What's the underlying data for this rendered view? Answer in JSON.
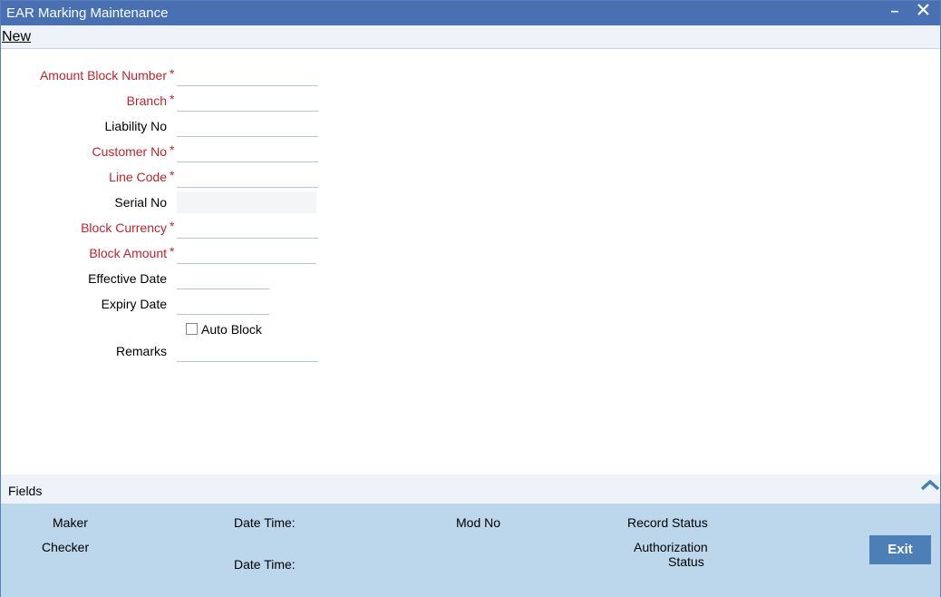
{
  "window": {
    "title": "EAR Marking Maintenance"
  },
  "toolbar": {
    "new_label": "New"
  },
  "form": {
    "amount_block_number": {
      "label": "Amount Block Number",
      "value": ""
    },
    "branch": {
      "label": "Branch",
      "value": ""
    },
    "liability_no": {
      "label": "Liability No",
      "value": ""
    },
    "customer_no": {
      "label": "Customer No",
      "value": ""
    },
    "line_code": {
      "label": "Line Code",
      "value": ""
    },
    "serial_no": {
      "label": "Serial No",
      "value": ""
    },
    "block_currency": {
      "label": "Block Currency",
      "value": ""
    },
    "block_amount": {
      "label": "Block Amount",
      "value": ""
    },
    "effective_date": {
      "label": "Effective Date",
      "value": ""
    },
    "expiry_date": {
      "label": "Expiry Date",
      "value": ""
    },
    "auto_block": {
      "label": "Auto Block",
      "checked": false
    },
    "remarks": {
      "label": "Remarks",
      "value": ""
    },
    "required_marker": "*"
  },
  "fields_bar": {
    "label": "Fields"
  },
  "footer": {
    "maker": "Maker",
    "checker": "Checker",
    "date_time_1": "Date Time:",
    "date_time_2": "Date Time:",
    "mod_no": "Mod No",
    "record_status": "Record Status",
    "authorization_status_line1": "Authorization",
    "authorization_status_line2": "Status",
    "exit_label": "Exit"
  },
  "colors": {
    "title_bar": "#4a70b4",
    "required_label": "#c0232b",
    "footer_bg": "#bcd6ec",
    "exit_button": "#4b7fb5"
  },
  "icons": {
    "minimize": "minimize-icon",
    "close": "close-icon",
    "collapse": "chevron-up-icon"
  }
}
